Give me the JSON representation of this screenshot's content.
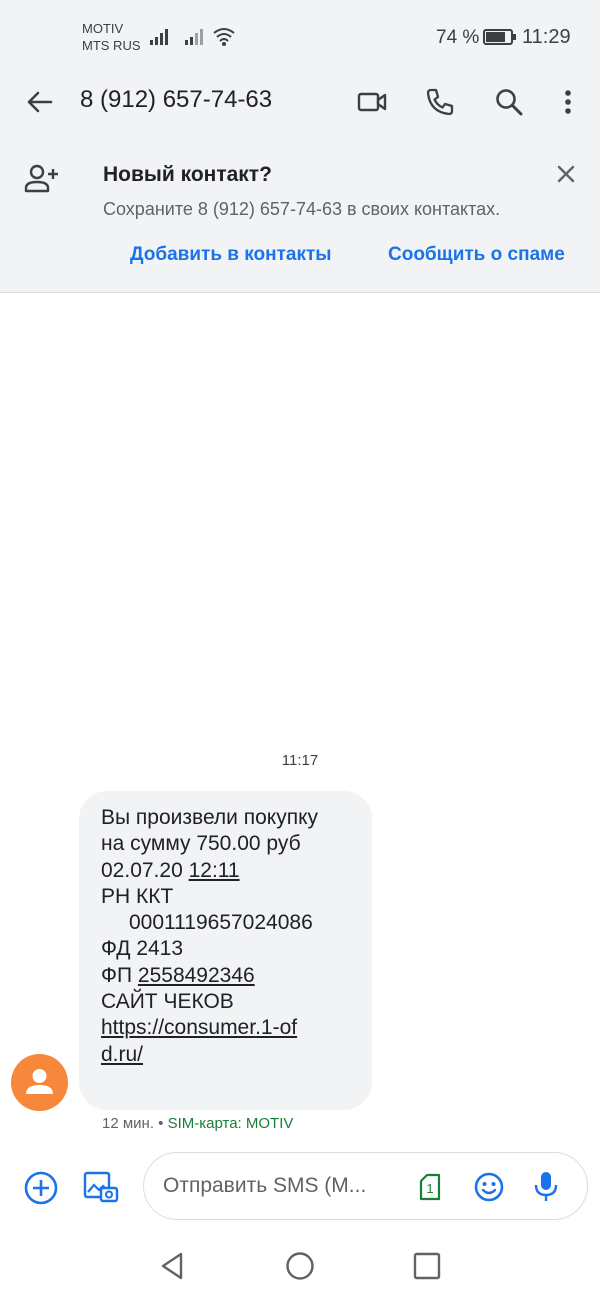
{
  "status_bar": {
    "carrier_line1": "MOTIV",
    "carrier_line2": "MTS RUS",
    "battery_percent": "74 %",
    "time": "11:29"
  },
  "app_bar": {
    "title": "8 (912) 657-74-63",
    "icons": [
      "back-arrow-icon",
      "video-call-icon",
      "phone-icon",
      "search-icon",
      "more-vert-icon"
    ]
  },
  "banner": {
    "title": "Новый контакт?",
    "subtitle": "Сохраните 8 (912) 657-74-63 в своих контактах.",
    "add_label": "Добавить в контакты",
    "spam_label": "Сообщить о спаме"
  },
  "conversation": {
    "timestamp": "11:17",
    "message": {
      "line1": "Вы произвели покупку",
      "line2": "на сумму 750.00 руб",
      "date": "02.07.20",
      "time": "12:11",
      "line4": "РН ККТ",
      "rn": "0001119657024086",
      "fd": "ФД 2413",
      "fp_label": "ФП",
      "fp_value": "2558492346",
      "site_label": "САЙТ ЧЕКОВ",
      "url_part1": "https://consumer.1-of",
      "url_part2": "d.ru/"
    },
    "meta_age": "12 мин.",
    "meta_sim": "SIM-карта: MOTIV"
  },
  "compose": {
    "placeholder": "Отправить SMS (М...",
    "sim_number": "1"
  },
  "colors": {
    "accent": "#1a73e8",
    "avatar": "#f6873b",
    "sim_green": "#188038"
  }
}
